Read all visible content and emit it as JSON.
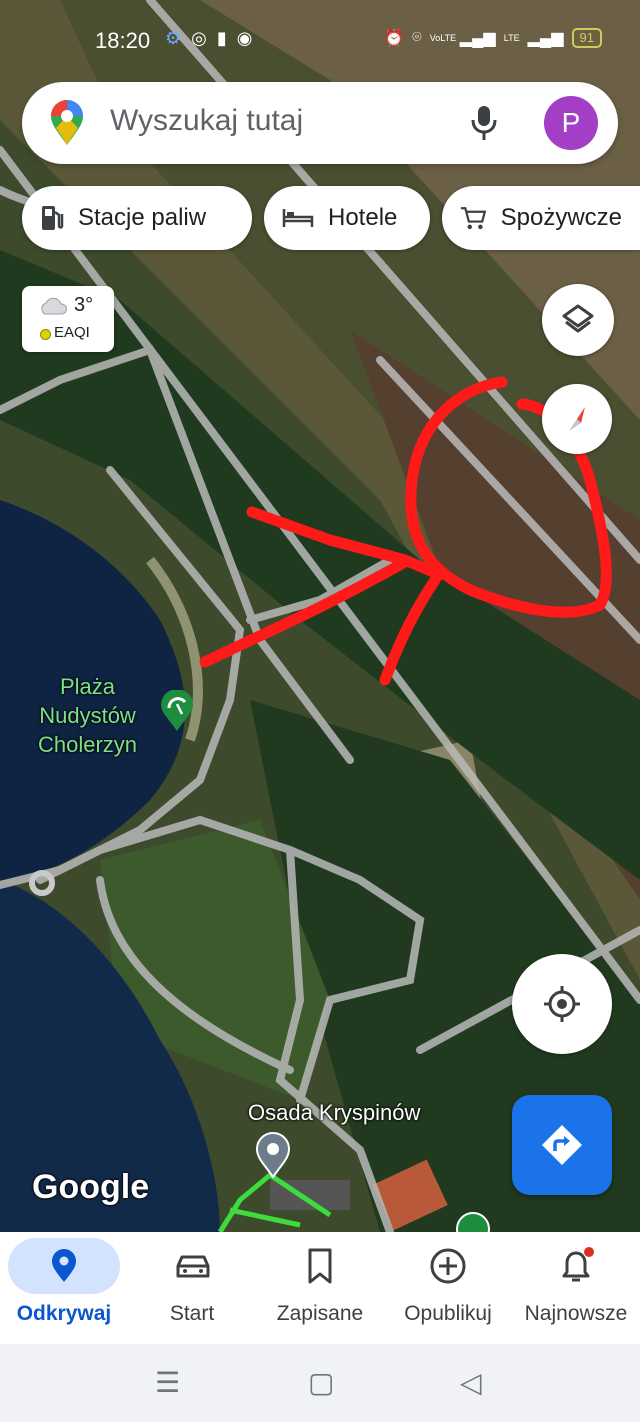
{
  "status_bar": {
    "time": "18:20",
    "network_label": "VoLTE",
    "lte_label": "LTE",
    "battery": "91"
  },
  "search": {
    "placeholder": "Wyszukaj tutaj",
    "avatar_letter": "P"
  },
  "chips": [
    {
      "label": "Stacje paliw",
      "icon": "gas-station-icon"
    },
    {
      "label": "Hotele",
      "icon": "bed-icon"
    },
    {
      "label": "Spożywcze",
      "icon": "cart-icon"
    }
  ],
  "weather": {
    "temperature": "3°",
    "air_quality": "EAQI"
  },
  "map": {
    "places": {
      "beach_line1": "Plaża",
      "beach_line2": "Nudystów",
      "beach_line3": "Cholerzyn",
      "settlement": "Osada Kryspinów"
    },
    "attribution": "Google"
  },
  "bottom_nav": [
    {
      "label": "Odkrywaj",
      "icon": "location-pin-icon",
      "active": true
    },
    {
      "label": "Start",
      "icon": "car-icon",
      "active": false
    },
    {
      "label": "Zapisane",
      "icon": "bookmark-icon",
      "active": false
    },
    {
      "label": "Opublikuj",
      "icon": "add-circle-icon",
      "active": false
    },
    {
      "label": "Najnowsze",
      "icon": "bell-icon",
      "active": false
    }
  ],
  "colors": {
    "accent": "#1a73e8",
    "annotation": "#ff1a1a",
    "active_nav": "#0b57d0"
  }
}
